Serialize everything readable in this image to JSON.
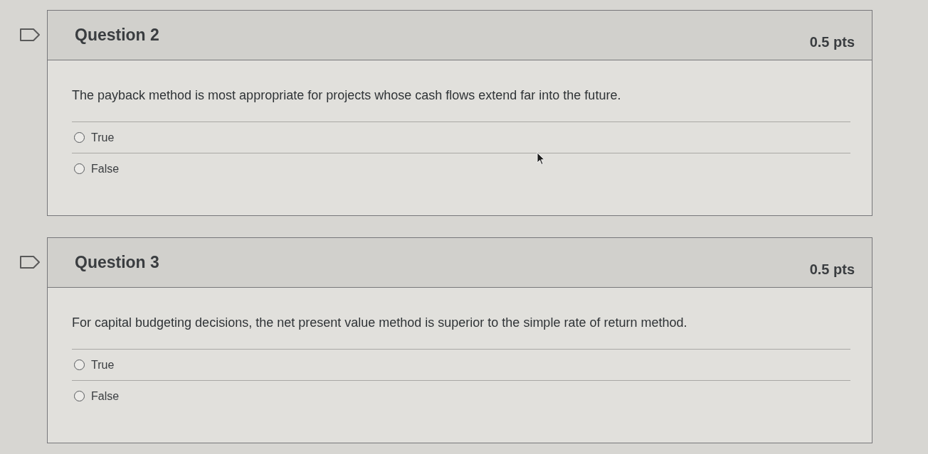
{
  "questions": [
    {
      "title": "Question 2",
      "points": "0.5 pts",
      "flagged": false,
      "text": "The payback method is most appropriate for projects whose cash flows extend far into the future.",
      "answers": [
        {
          "label": "True",
          "selected": false
        },
        {
          "label": "False",
          "selected": false
        }
      ]
    },
    {
      "title": "Question 3",
      "points": "0.5 pts",
      "flagged": false,
      "text": "For capital budgeting decisions, the net present value method is superior to the simple rate of return method.",
      "answers": [
        {
          "label": "True",
          "selected": false
        },
        {
          "label": "False",
          "selected": false
        }
      ]
    }
  ]
}
